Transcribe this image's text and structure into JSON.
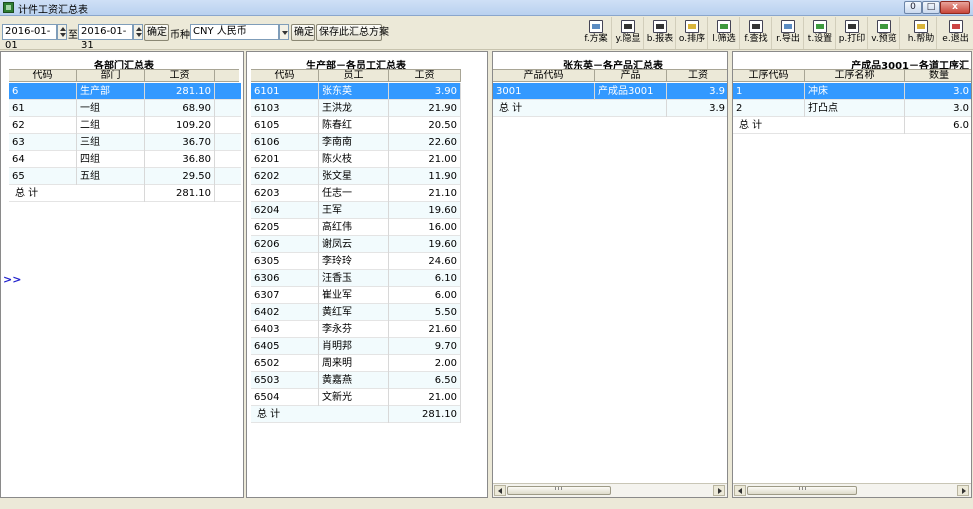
{
  "window": {
    "title": "计件工资汇总表",
    "min_label": "0",
    "max_label": "□",
    "close_label": "x"
  },
  "filter": {
    "start_date": "2016-01-01",
    "to_label": "至",
    "end_date": "2016-01-31",
    "confirm_label": "确定",
    "currency_label": "币种",
    "currency_value": "CNY 人民币",
    "confirm2_label": "确定",
    "save_label": "保存此汇总方案"
  },
  "tools": [
    {
      "name": "scheme",
      "label": "f.方案"
    },
    {
      "name": "hide-show",
      "label": "y.隐显"
    },
    {
      "name": "report",
      "label": "b.报表"
    },
    {
      "name": "sort",
      "label": "o.排序"
    },
    {
      "name": "filter",
      "label": "l.筛选"
    },
    {
      "name": "find",
      "label": "f.查找"
    },
    {
      "name": "export",
      "label": "r.导出"
    },
    {
      "name": "settings",
      "label": "t.设置"
    },
    {
      "name": "print",
      "label": "p.打印"
    },
    {
      "name": "preview",
      "label": "v.预览"
    },
    {
      "name": "help",
      "label": "h.帮助"
    },
    {
      "name": "exit",
      "label": "e.退出"
    }
  ],
  "expander_label": ">>",
  "dept": {
    "title": "各部门汇总表",
    "headers": [
      "代码",
      "部门",
      "工资"
    ],
    "rows": [
      [
        "6",
        "生产部",
        "281.10"
      ],
      [
        "61",
        "一组",
        "68.90"
      ],
      [
        "62",
        "二组",
        "109.20"
      ],
      [
        "63",
        "三组",
        "36.70"
      ],
      [
        "64",
        "四组",
        "36.80"
      ],
      [
        "65",
        "五组",
        "29.50"
      ]
    ],
    "total_label": "总  计",
    "total_value": "281.10"
  },
  "emp": {
    "title": "生产部－各员工汇总表",
    "headers": [
      "代码",
      "员工",
      "工资"
    ],
    "rows": [
      [
        "6101",
        "张东英",
        "3.90"
      ],
      [
        "6103",
        "王洪龙",
        "21.90"
      ],
      [
        "6105",
        "陈春红",
        "20.50"
      ],
      [
        "6106",
        "李南南",
        "22.60"
      ],
      [
        "6201",
        "陈火枝",
        "21.00"
      ],
      [
        "6202",
        "张文星",
        "11.90"
      ],
      [
        "6203",
        "任志一",
        "21.10"
      ],
      [
        "6204",
        "王军",
        "19.60"
      ],
      [
        "6205",
        "高红伟",
        "16.00"
      ],
      [
        "6206",
        "谢凤云",
        "19.60"
      ],
      [
        "6305",
        "李玲玲",
        "24.60"
      ],
      [
        "6306",
        "汪香玉",
        "6.10"
      ],
      [
        "6307",
        "崔业军",
        "6.00"
      ],
      [
        "6402",
        "黄红军",
        "5.50"
      ],
      [
        "6403",
        "李永芬",
        "21.60"
      ],
      [
        "6405",
        "肖明邦",
        "9.70"
      ],
      [
        "6502",
        "周来明",
        "2.00"
      ],
      [
        "6503",
        "黄嘉燕",
        "6.50"
      ],
      [
        "6504",
        "文新光",
        "21.00"
      ]
    ],
    "total_label": "总  计",
    "total_value": "281.10"
  },
  "prod": {
    "title": "张东英－各产品汇总表",
    "headers": [
      "产品代码",
      "产品",
      "工资"
    ],
    "rows": [
      [
        "3001",
        "产成品3001",
        "3.9"
      ]
    ],
    "total_label": "总  计",
    "total_value": "3.9"
  },
  "proc": {
    "title": "产成品3001－各道工序汇",
    "headers": [
      "工序代码",
      "工序名称",
      "数量"
    ],
    "rows": [
      [
        "1",
        "冲床",
        "3.0"
      ],
      [
        "2",
        "打凸点",
        "3.0"
      ]
    ],
    "total_label": "总  计",
    "total_value": "6.0"
  },
  "colors": {
    "selection": "#3399FF",
    "alt_row": "#F2FBFD",
    "chrome": "#ECE9D8"
  }
}
